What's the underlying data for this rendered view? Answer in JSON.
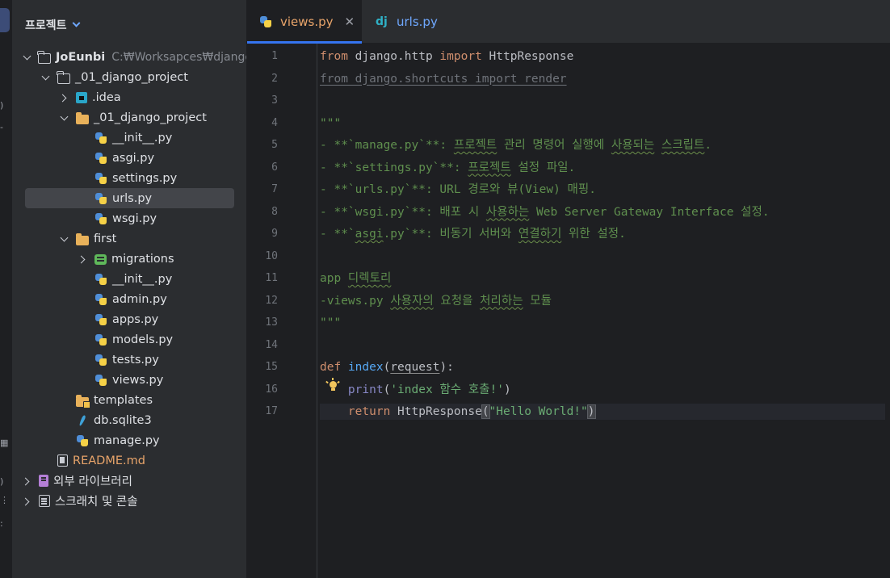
{
  "panel": {
    "title": "프로젝트"
  },
  "tree": [
    {
      "label": "JoEunbi",
      "path": "C:₩Worksapces₩django",
      "icon": "folder-outline-icon",
      "expand": "open",
      "indent": 0,
      "bold": true
    },
    {
      "label": "_01_django_project",
      "icon": "folder-outline-icon",
      "expand": "open",
      "indent": 1
    },
    {
      "label": ".idea",
      "icon": "idea-folder-icon",
      "expand": "closed",
      "indent": 2
    },
    {
      "label": "_01_django_project",
      "icon": "folder-icon",
      "expand": "open",
      "indent": 2
    },
    {
      "label": "__init__.py",
      "icon": "python-file-icon",
      "expand": "none",
      "indent": 3
    },
    {
      "label": "asgi.py",
      "icon": "python-file-icon",
      "expand": "none",
      "indent": 3
    },
    {
      "label": "settings.py",
      "icon": "python-file-icon",
      "expand": "none",
      "indent": 3
    },
    {
      "label": "urls.py",
      "icon": "python-file-icon",
      "expand": "none",
      "indent": 3,
      "selected": true
    },
    {
      "label": "wsgi.py",
      "icon": "python-file-icon",
      "expand": "none",
      "indent": 3
    },
    {
      "label": "first",
      "icon": "folder-icon",
      "expand": "open",
      "indent": 2
    },
    {
      "label": "migrations",
      "icon": "migrations-folder-icon",
      "expand": "closed",
      "indent": 3
    },
    {
      "label": "__init__.py",
      "icon": "python-file-icon",
      "expand": "none",
      "indent": 3
    },
    {
      "label": "admin.py",
      "icon": "python-file-icon",
      "expand": "none",
      "indent": 3
    },
    {
      "label": "apps.py",
      "icon": "python-file-icon",
      "expand": "none",
      "indent": 3
    },
    {
      "label": "models.py",
      "icon": "python-file-icon",
      "expand": "none",
      "indent": 3
    },
    {
      "label": "tests.py",
      "icon": "python-file-icon",
      "expand": "none",
      "indent": 3
    },
    {
      "label": "views.py",
      "icon": "python-file-icon",
      "expand": "none",
      "indent": 3
    },
    {
      "label": "templates",
      "icon": "templates-folder-icon",
      "expand": "none",
      "indent": 2
    },
    {
      "label": "db.sqlite3",
      "icon": "database-file-icon",
      "expand": "none",
      "indent": 2
    },
    {
      "label": "manage.py",
      "icon": "python-file-icon",
      "expand": "none",
      "indent": 2
    },
    {
      "label": "README.md",
      "icon": "markdown-file-icon",
      "expand": "none",
      "indent": 1,
      "orange": true
    },
    {
      "label": "외부 라이브러리",
      "icon": "library-icon",
      "expand": "closed",
      "indent": 0
    },
    {
      "label": "스크래치 및 콘솔",
      "icon": "scratch-icon",
      "expand": "closed",
      "indent": 0
    }
  ],
  "tabs": [
    {
      "label": "views.py",
      "icon": "python-file-icon",
      "active": true,
      "closable": true
    },
    {
      "label": "urls.py",
      "icon": "django-icon",
      "icon_text": "dj",
      "active": false,
      "closable": false
    }
  ],
  "editor": {
    "current_line": 17,
    "lines": [
      [
        {
          "t": "from",
          "c": "kw"
        },
        {
          "t": " django.http ",
          "c": "plain"
        },
        {
          "t": "import",
          "c": "kw"
        },
        {
          "t": " HttpResponse",
          "c": "plain"
        }
      ],
      [
        {
          "t": "from django.shortcuts import render",
          "c": "unused"
        }
      ],
      [],
      [
        {
          "t": "\"\"\"",
          "c": "doc"
        }
      ],
      [
        {
          "t": "- **`manage.py`**: ",
          "c": "doc"
        },
        {
          "t": "프로젝트",
          "c": "doc squig"
        },
        {
          "t": " 관리 명령어 실행에 ",
          "c": "doc"
        },
        {
          "t": "사용되는",
          "c": "doc squig"
        },
        {
          "t": " ",
          "c": "doc"
        },
        {
          "t": "스크립트",
          "c": "doc squig"
        },
        {
          "t": ".",
          "c": "doc"
        }
      ],
      [
        {
          "t": "- **`settings.py`**: ",
          "c": "doc"
        },
        {
          "t": "프로젝트",
          "c": "doc squig"
        },
        {
          "t": " 설정 파일.",
          "c": "doc"
        }
      ],
      [
        {
          "t": "- **`urls.py`**: URL 경로와 뷰(View) 매핑.",
          "c": "doc"
        }
      ],
      [
        {
          "t": "- **`wsgi.py`**: 배포 시 ",
          "c": "doc"
        },
        {
          "t": "사용하는",
          "c": "doc squig"
        },
        {
          "t": " Web Server Gateway Interface 설정.",
          "c": "doc"
        }
      ],
      [
        {
          "t": "- **`",
          "c": "doc"
        },
        {
          "t": "asgi",
          "c": "doc squig"
        },
        {
          "t": ".py`**: 비동기 서버와 ",
          "c": "doc"
        },
        {
          "t": "연결하기",
          "c": "doc squig"
        },
        {
          "t": " 위한 설정.",
          "c": "doc"
        }
      ],
      [],
      [
        {
          "t": "app ",
          "c": "doc"
        },
        {
          "t": "디렉토리",
          "c": "doc squig"
        }
      ],
      [
        {
          "t": "-views.py ",
          "c": "doc"
        },
        {
          "t": "사용자의",
          "c": "doc squig"
        },
        {
          "t": " 요청을 ",
          "c": "doc"
        },
        {
          "t": "처리하는",
          "c": "doc squig"
        },
        {
          "t": " 모듈",
          "c": "doc"
        }
      ],
      [
        {
          "t": "\"\"\"",
          "c": "doc"
        }
      ],
      [],
      [
        {
          "t": "def",
          "c": "kw"
        },
        {
          "t": " ",
          "c": "plain"
        },
        {
          "t": "index",
          "c": "fn"
        },
        {
          "t": "(",
          "c": "plain"
        },
        {
          "t": "request",
          "c": "param param-u"
        },
        {
          "t": "):",
          "c": "plain"
        }
      ],
      [
        {
          "t": "    ",
          "c": "plain"
        },
        {
          "t": "print",
          "c": "builtin"
        },
        {
          "t": "(",
          "c": "plain"
        },
        {
          "t": "'index 함수 호출!'",
          "c": "str"
        },
        {
          "t": ")",
          "c": "plain"
        }
      ],
      [
        {
          "t": "    ",
          "c": "plain"
        },
        {
          "t": "return",
          "c": "kw"
        },
        {
          "t": " HttpResponse",
          "c": "plain"
        },
        {
          "t": "(",
          "c": "plain bracket"
        },
        {
          "t": "\"Hello World!\"",
          "c": "str"
        },
        {
          "t": ")",
          "c": "plain bracket"
        }
      ]
    ]
  },
  "colors": {
    "accent": "#3574f0",
    "keyword": "#cf8e6d",
    "docstring": "#5f8f4e",
    "string": "#6aab73",
    "function": "#56a8f5",
    "selection": "#43454a"
  }
}
